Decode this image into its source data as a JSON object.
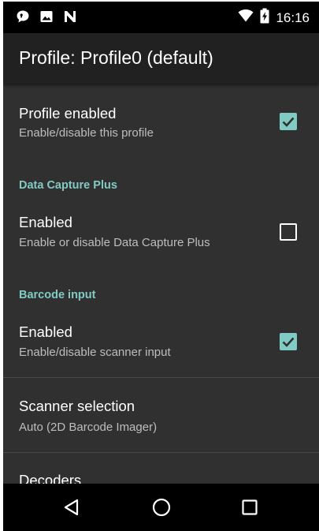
{
  "status_bar": {
    "time": "16:16",
    "left_icons": [
      "chat-bubble-icon",
      "image-icon",
      "n-icon"
    ],
    "right_icons": [
      "wifi-icon",
      "battery-icon"
    ]
  },
  "app_bar": {
    "title": "Profile: Profile0 (default)"
  },
  "colors": {
    "accent": "#80cbc4",
    "background": "#303030",
    "app_bar": "#212121",
    "status_bar": "#000000"
  },
  "preferences": {
    "profile_enabled": {
      "title": "Profile enabled",
      "summary": "Enable/disable this profile",
      "checked": true
    },
    "data_capture_plus": {
      "category": "Data Capture Plus",
      "enabled": {
        "title": "Enabled",
        "summary": "Enable or disable Data Capture Plus",
        "checked": false
      }
    },
    "barcode_input": {
      "category": "Barcode input",
      "enabled": {
        "title": "Enabled",
        "summary": "Enable/disable scanner input",
        "checked": true
      },
      "scanner_selection": {
        "title": "Scanner selection",
        "summary": "Auto (2D Barcode Imager)"
      },
      "decoders": {
        "title": "Decoders"
      }
    }
  },
  "nav_bar": {
    "buttons": [
      "back-icon",
      "home-icon",
      "recents-icon"
    ]
  }
}
